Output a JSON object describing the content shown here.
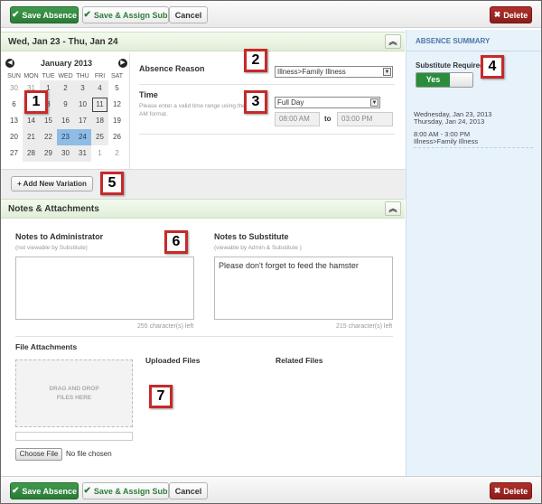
{
  "toolbar": {
    "save_label": "Save Absence",
    "assign_label": "Save & Assign Sub",
    "cancel_label": "Cancel",
    "delete_label": "Delete"
  },
  "absence": {
    "date_range": "Wed, Jan 23 - Thu, Jan 24",
    "reason_label": "Absence Reason",
    "reason_value": "Illness>Family Illness",
    "time_label": "Time",
    "time_help": "Please enter a valid time range using the HH:MM AM format.",
    "time_value": "Full Day",
    "start_time": "08:00 AM",
    "to_label": "to",
    "end_time": "03:00 PM",
    "add_variation_label": "+ Add New Variation"
  },
  "calendar": {
    "month": "January 2013",
    "weekdays": [
      "SUN",
      "MON",
      "TUE",
      "WED",
      "THU",
      "FRI",
      "SAT"
    ],
    "days": [
      [
        "30",
        "31",
        "1",
        "2",
        "3",
        "4",
        "5"
      ],
      [
        "6",
        "7",
        "8",
        "9",
        "10",
        "11",
        "12"
      ],
      [
        "13",
        "14",
        "15",
        "16",
        "17",
        "18",
        "19"
      ],
      [
        "20",
        "21",
        "22",
        "23",
        "24",
        "25",
        "26"
      ],
      [
        "27",
        "28",
        "29",
        "30",
        "31",
        "1",
        "2"
      ]
    ],
    "selected": [
      "23",
      "24"
    ],
    "today": "11"
  },
  "summary": {
    "title": "ABSENCE SUMMARY",
    "substitute_required_label": "Substitute Required",
    "toggle_label": "Yes",
    "date_line1": "Wednesday, Jan 23, 2013",
    "date_line2": "Thursday, Jan 24, 2013",
    "time_line": "8:00 AM - 3:00 PM",
    "reason_line": "Illness>Family Illness"
  },
  "notes": {
    "section_title": "Notes & Attachments",
    "admin_label": "Notes to Administrator",
    "admin_sub": "(not viewable by Substitute)",
    "admin_value": "",
    "admin_count": "255 character(s) left",
    "sub_label": "Notes to Substitute",
    "sub_sub": "(viewable by Admin & Substitute )",
    "sub_value": "Please don't forget to feed the hamster",
    "sub_count": "215 character(s) left"
  },
  "files": {
    "attachments_label": "File Attachments",
    "uploaded_label": "Uploaded Files",
    "related_label": "Related Files",
    "drop_text": "DRAG AND DROP FILES HERE",
    "choose_label": "Choose File",
    "no_file_text": "No file chosen"
  },
  "callouts": [
    "1",
    "2",
    "3",
    "4",
    "5",
    "6",
    "7"
  ],
  "colors": {
    "primary_green": "#2a7a36",
    "delete_red": "#9a2420",
    "selected_day": "#8fbce4",
    "summary_bg": "#e8f2fb",
    "callout_border": "#c62a2a"
  }
}
